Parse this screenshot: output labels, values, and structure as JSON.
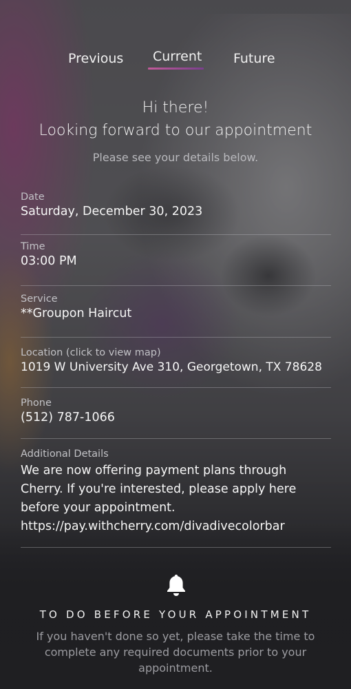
{
  "tabs": {
    "previous": "Previous",
    "current": "Current",
    "future": "Future",
    "active": "Current"
  },
  "greeting": {
    "line1": "Hi there!",
    "line2": "Looking forward to our appointment",
    "subtext": "Please see your details below."
  },
  "details": {
    "date": {
      "label": "Date",
      "value": "Saturday, December 30, 2023"
    },
    "time": {
      "label": "Time",
      "value": "03:00 PM"
    },
    "service": {
      "label": "Service",
      "value": "**Groupon Haircut"
    },
    "location": {
      "label": "Location (click to view map)",
      "value": "1019 W University Ave 310, Georgetown, TX 78628"
    },
    "phone": {
      "label": "Phone",
      "value": "(512) 787-1066"
    },
    "additional": {
      "label": "Additional Details",
      "value": "We are now offering payment plans through Cherry. If you're interested, please apply here before your appointment. https://pay.withcherry.com/divadivecolorbar"
    }
  },
  "todo": {
    "icon": "bell-icon",
    "heading": "TO DO BEFORE YOUR APPOINTMENT",
    "text": "If you haven't done so yet, please take the time to complete any required documents prior to your appointment."
  },
  "colors": {
    "tab_accent_start": "#c35a9a",
    "tab_accent_end": "#7b3f8e",
    "label_gray": "#c2c2c6",
    "muted_gray": "#9c9ca1"
  }
}
